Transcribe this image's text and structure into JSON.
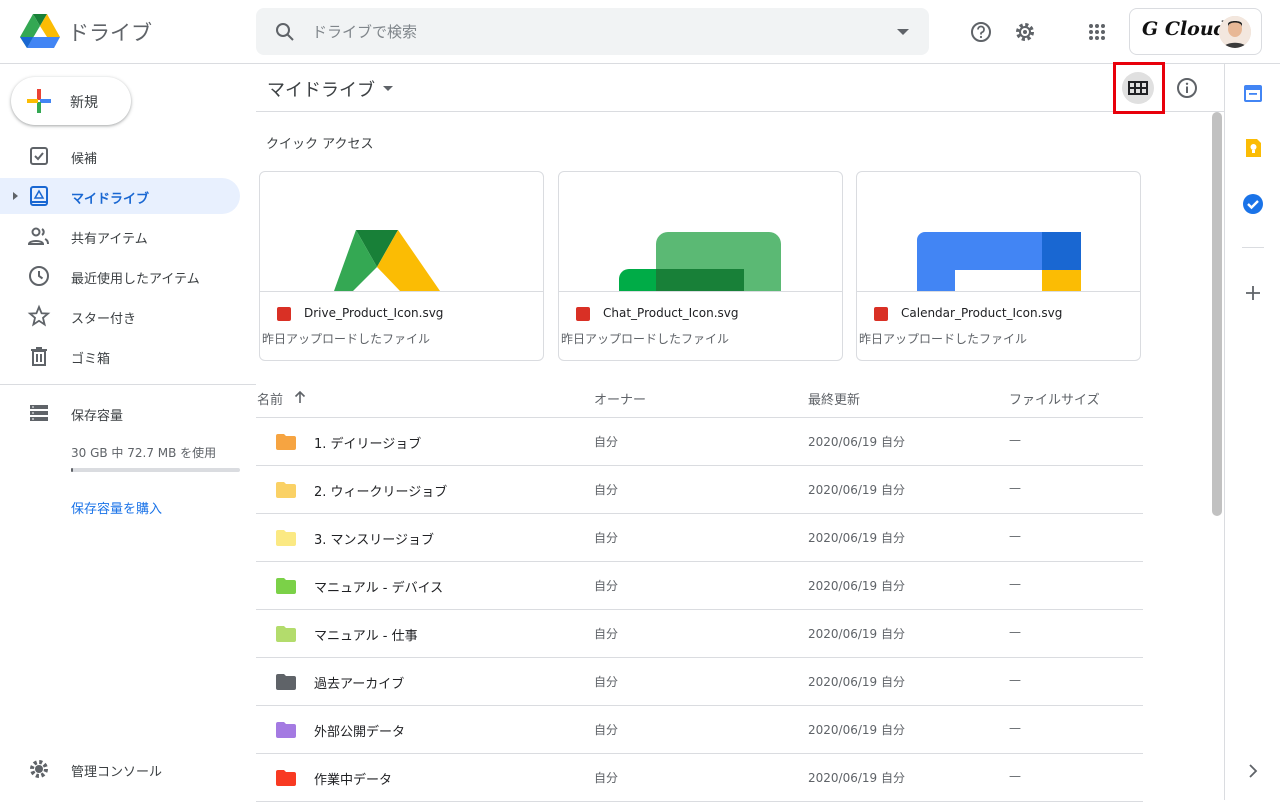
{
  "header": {
    "app_name": "ドライブ",
    "search_placeholder": "ドライブで検索",
    "account_brand": "G Cloud"
  },
  "sidebar": {
    "new_label": "新規",
    "items": [
      {
        "label": "候補",
        "icon": "check-square-icon"
      },
      {
        "label": "マイドライブ",
        "icon": "my-drive-icon",
        "active": true
      },
      {
        "label": "共有アイテム",
        "icon": "people-icon"
      },
      {
        "label": "最近使用したアイテム",
        "icon": "clock-icon"
      },
      {
        "label": "スター付き",
        "icon": "star-icon"
      },
      {
        "label": "ゴミ箱",
        "icon": "trash-icon"
      }
    ],
    "storage_label": "保存容量",
    "storage_usage": "30 GB 中 72.7 MB を使用",
    "storage_fraction": 0.0024,
    "buy_storage": "保存容量を購入",
    "admin_console": "管理コンソール"
  },
  "main": {
    "title": "マイドライブ",
    "quick_access_title": "クイック アクセス",
    "quick_access": [
      {
        "name": "Drive_Product_Icon.svg",
        "sub": "昨日アップロードしたファイル"
      },
      {
        "name": "Chat_Product_Icon.svg",
        "sub": "昨日アップロードしたファイル"
      },
      {
        "name": "Calendar_Product_Icon.svg",
        "sub": "昨日アップロードしたファイル"
      }
    ],
    "columns": {
      "name": "名前",
      "owner": "オーナー",
      "modified": "最終更新",
      "size": "ファイルサイズ"
    },
    "files": [
      {
        "name": "1. デイリージョブ",
        "owner": "自分",
        "modified": "2020/06/19 自分",
        "size": "—",
        "color": "#f6a441"
      },
      {
        "name": "2. ウィークリージョブ",
        "owner": "自分",
        "modified": "2020/06/19 自分",
        "size": "—",
        "color": "#fad165"
      },
      {
        "name": "3. マンスリージョブ",
        "owner": "自分",
        "modified": "2020/06/19 自分",
        "size": "—",
        "color": "#fbe983"
      },
      {
        "name": "マニュアル - デバイス",
        "owner": "自分",
        "modified": "2020/06/19 自分",
        "size": "—",
        "color": "#7bd148"
      },
      {
        "name": "マニュアル - 仕事",
        "owner": "自分",
        "modified": "2020/06/19 自分",
        "size": "—",
        "color": "#b3dc6c"
      },
      {
        "name": "過去アーカイブ",
        "owner": "自分",
        "modified": "2020/06/19 自分",
        "size": "—",
        "color": "#5f6368"
      },
      {
        "name": "外部公開データ",
        "owner": "自分",
        "modified": "2020/06/19 自分",
        "size": "—",
        "color": "#a47ae2"
      },
      {
        "name": "作業中データ",
        "owner": "自分",
        "modified": "2020/06/19 自分",
        "size": "—",
        "color": "#f83a22"
      }
    ]
  }
}
